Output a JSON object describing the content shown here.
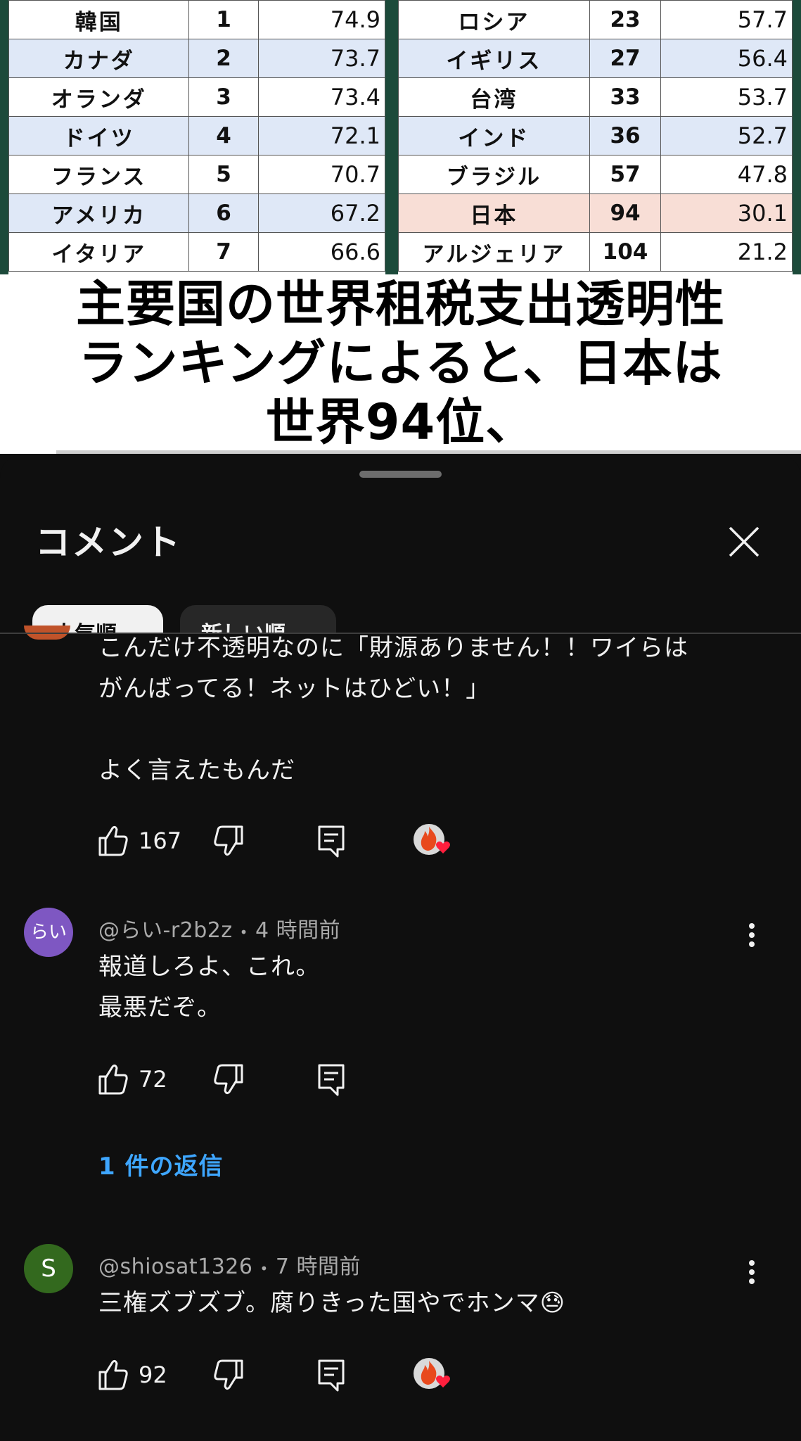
{
  "video": {
    "table_left": [
      {
        "country": "韓国",
        "rank": "1",
        "score": "74.9",
        "highlight": false
      },
      {
        "country": "カナダ",
        "rank": "2",
        "score": "73.7",
        "highlight": false
      },
      {
        "country": "オランダ",
        "rank": "3",
        "score": "73.4",
        "highlight": false
      },
      {
        "country": "ドイツ",
        "rank": "4",
        "score": "72.1",
        "highlight": false
      },
      {
        "country": "フランス",
        "rank": "5",
        "score": "70.7",
        "highlight": false
      },
      {
        "country": "アメリカ",
        "rank": "6",
        "score": "67.2",
        "highlight": false
      },
      {
        "country": "イタリア",
        "rank": "7",
        "score": "66.6",
        "highlight": false
      }
    ],
    "table_right": [
      {
        "country": "ロシア",
        "rank": "23",
        "score": "57.7",
        "highlight": false
      },
      {
        "country": "イギリス",
        "rank": "27",
        "score": "56.4",
        "highlight": false
      },
      {
        "country": "台湾",
        "rank": "33",
        "score": "53.7",
        "highlight": false
      },
      {
        "country": "インド",
        "rank": "36",
        "score": "52.7",
        "highlight": false
      },
      {
        "country": "ブラジル",
        "rank": "57",
        "score": "47.8",
        "highlight": false
      },
      {
        "country": "日本",
        "rank": "94",
        "score": "30.1",
        "highlight": true
      },
      {
        "country": "アルジェリア",
        "rank": "104",
        "score": "21.2",
        "highlight": false
      }
    ],
    "caption_lines": [
      "主要国の世界租税支出透明性",
      "ランキングによると、日本は",
      "世界94位、"
    ]
  },
  "comments_panel": {
    "title": "コメント",
    "close_icon": "close-icon",
    "sort_chips": [
      "人気順",
      "新しい順"
    ],
    "comments": [
      {
        "text": "こんだけ不透明なのに「財源ありません！！ワイらは\nがんばってる！ネットはひどい！」\n\nよく言えたもんだ",
        "likes": "167",
        "creator_heart": true
      },
      {
        "avatar_label": "らい",
        "avatar_color": "#7e57c2",
        "author": "@らい-r2b2z",
        "time": "4 時間前",
        "text": "報道しろよ、これ。\n最悪だぞ。",
        "likes": "72",
        "creator_heart": false,
        "replies_label": "1 件の返信"
      },
      {
        "avatar_label": "S",
        "avatar_color": "#33691e",
        "author": "@shiosat1326",
        "time": "7 時間前",
        "text": "三権ズブズブ。腐りきった国やでホンマ😓",
        "likes": "92",
        "creator_heart": true
      }
    ],
    "meta_separator": "•"
  },
  "colors": {
    "background": "#0f0f0f",
    "link": "#3ea6ff",
    "highlight_row": "#f8ded6",
    "alt_row": "#dfe8f7"
  }
}
